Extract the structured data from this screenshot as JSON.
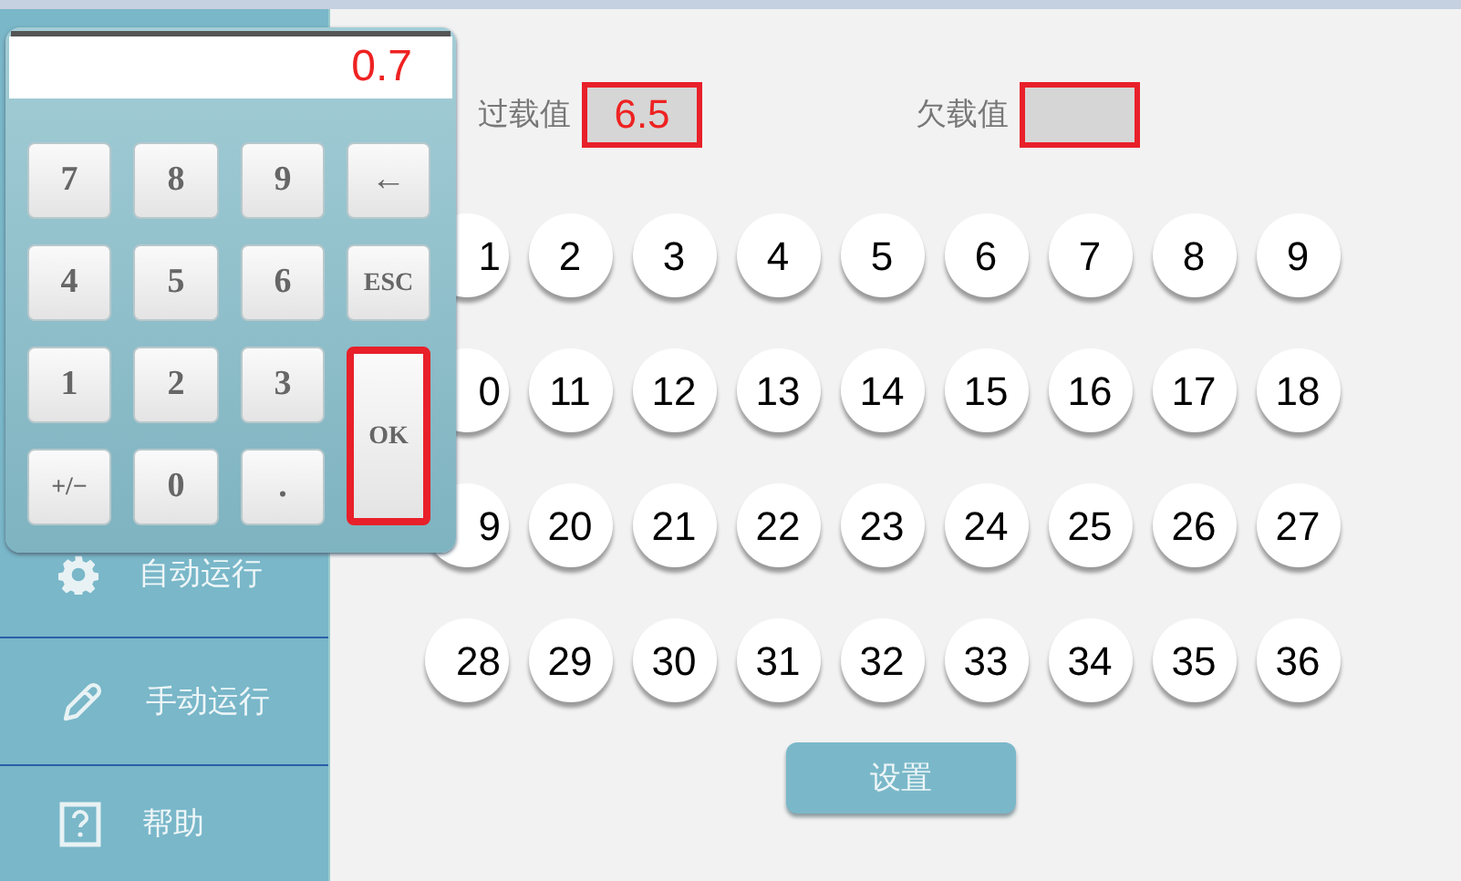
{
  "sidebar": {
    "items": [
      {
        "label": "自动运行",
        "kind": "gear"
      },
      {
        "label": "手动运行",
        "kind": "pencil"
      },
      {
        "label": "帮助",
        "kind": "help"
      }
    ]
  },
  "fields": [
    {
      "label": "过载值",
      "value": "6.5",
      "highlighted": true
    },
    {
      "label": "欠载值",
      "highlighted": true
    }
  ],
  "channels": [
    "1",
    "2",
    "3",
    "4",
    "5",
    "6",
    "7",
    "8",
    "9",
    "0",
    "11",
    "12",
    "13",
    "14",
    "15",
    "16",
    "17",
    "18",
    "9",
    "20",
    "21",
    "22",
    "23",
    "24",
    "25",
    "26",
    "27",
    "28",
    "29",
    "30",
    "31",
    "32",
    "33",
    "34",
    "35",
    "36"
  ],
  "set_button": "设置",
  "keypad": {
    "display": "0.7",
    "keys": [
      {
        "label": "7",
        "highlighted": false
      },
      {
        "label": "8",
        "highlighted": false
      },
      {
        "label": "9",
        "highlighted": false
      },
      {
        "label": "←",
        "highlighted": false
      },
      {
        "label": "4",
        "highlighted": false
      },
      {
        "label": "5",
        "highlighted": false
      },
      {
        "label": "6",
        "highlighted": false
      },
      {
        "label": "ESC",
        "highlighted": false
      },
      {
        "label": "1",
        "highlighted": false
      },
      {
        "label": "2",
        "highlighted": false
      },
      {
        "label": "3",
        "highlighted": false
      },
      {
        "label": "OK",
        "kind": "tall",
        "highlighted": true
      },
      {
        "label": "+/−",
        "highlighted": false
      },
      {
        "label": "0",
        "highlighted": false
      },
      {
        "label": ".",
        "highlighted": false
      }
    ]
  }
}
